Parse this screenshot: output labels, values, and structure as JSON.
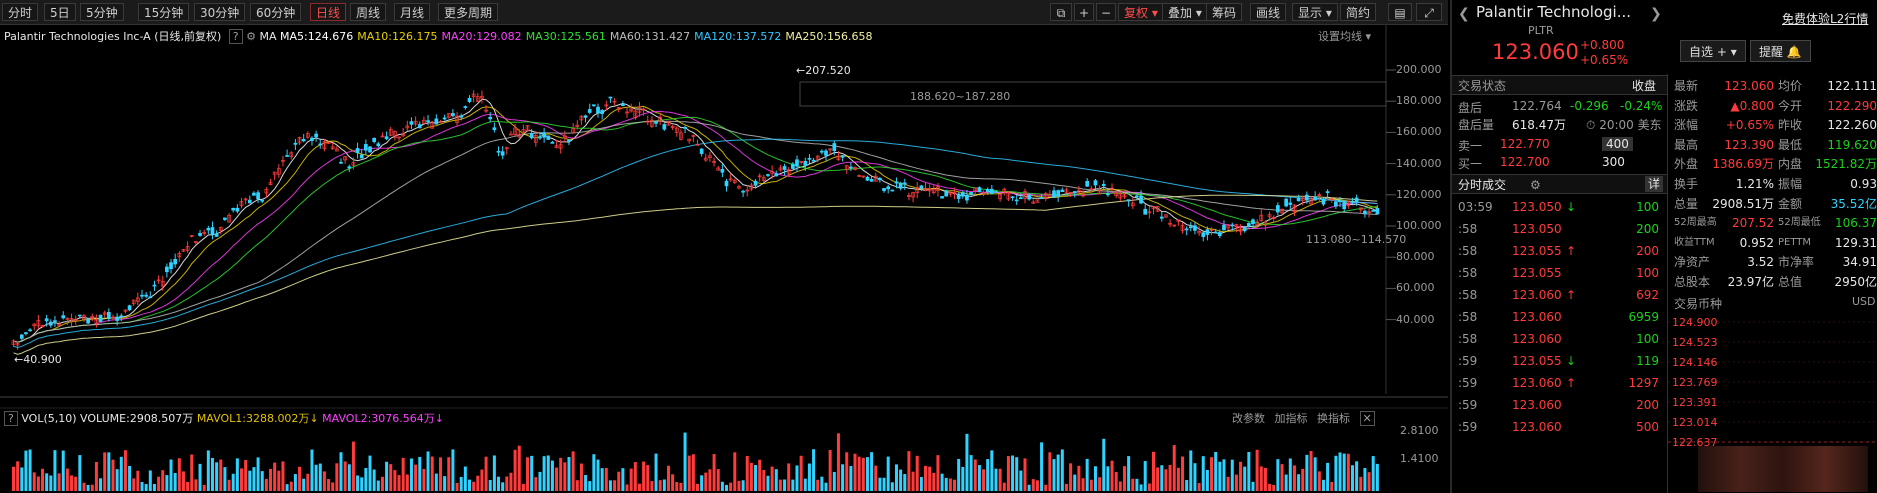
{
  "toolbar": {
    "periods": [
      "分时",
      "5日",
      "5分钟",
      "15分钟",
      "30分钟",
      "60分钟",
      "日线",
      "周线",
      "月线",
      "更多周期"
    ],
    "active_period": "日线",
    "right_buttons": [
      "复权",
      "叠加",
      "筹码",
      "画线",
      "显示",
      "简约"
    ]
  },
  "chart": {
    "title": "Palantir Technologies Inc-A (日线,前复权)",
    "ma_label": "MA",
    "ma": [
      {
        "label": "MA5:124.676",
        "color": "#ffffff"
      },
      {
        "label": "MA10:126.175",
        "color": "#e8d000"
      },
      {
        "label": "MA20:129.082",
        "color": "#ff40ff"
      },
      {
        "label": "MA30:125.561",
        "color": "#30e030"
      },
      {
        "label": "MA60:131.427",
        "color": "#bbbbbb"
      },
      {
        "label": "MA120:137.572",
        "color": "#30c8ff"
      },
      {
        "label": "MA250:156.658",
        "color": "#f0f0a0"
      }
    ],
    "settings_label": "设置均线",
    "price_axis": [
      "200.000",
      "180.000",
      "160.000",
      "140.000",
      "120.000",
      "100.000",
      "80.000",
      "60.000",
      "40.000"
    ],
    "annotations": {
      "high_label": "207.520",
      "range1": "188.620~187.280",
      "low_label": "113.080~114.570",
      "start_low": "40.900"
    }
  },
  "volume": {
    "title": "VOL(5,10)",
    "volume": "VOLUME:2908.507万",
    "mavol1": "MAVOL1:3288.002万",
    "mavol2": "MAVOL2:3076.564万",
    "links": [
      "改参数",
      "加指标",
      "换指标"
    ],
    "axis": [
      "2.8100",
      "1.4100"
    ]
  },
  "stock": {
    "name": "Palantir Technologi...",
    "code": "PLTR",
    "price": "123.060",
    "change": "+0.800",
    "change_pct": "+0.65%",
    "trial_link": "免费体验L2行情",
    "watch_button": "自选",
    "alert_button": "提醒"
  },
  "trade_status": {
    "title": "交易状态",
    "state": "收盘",
    "after_label": "盘后",
    "after_price": "122.764",
    "after_change": "-0.296",
    "after_pct": "-0.24%",
    "after_vol_label": "盘后量",
    "after_vol": "618.47万",
    "after_time": "20:00 美东",
    "ask_label": "卖一",
    "ask_price": "122.770",
    "ask_vol": "400",
    "bid_label": "买一",
    "bid_price": "122.700",
    "bid_vol": "300"
  },
  "ticks": {
    "title": "分时成交",
    "detail": "详",
    "rows": [
      {
        "time": "03:59",
        "price": "123.050",
        "arrow": "↓",
        "vol": "100",
        "pc": "red",
        "vc": "green"
      },
      {
        "time": ":58",
        "price": "123.050",
        "arrow": "",
        "vol": "200",
        "pc": "red",
        "vc": "green"
      },
      {
        "time": ":58",
        "price": "123.055",
        "arrow": "↑",
        "vol": "200",
        "pc": "red",
        "vc": "red"
      },
      {
        "time": ":58",
        "price": "123.055",
        "arrow": "",
        "vol": "100",
        "pc": "red",
        "vc": "red"
      },
      {
        "time": ":58",
        "price": "123.060",
        "arrow": "↑",
        "vol": "692",
        "pc": "red",
        "vc": "red"
      },
      {
        "time": ":58",
        "price": "123.060",
        "arrow": "",
        "vol": "6959",
        "pc": "red",
        "vc": "green"
      },
      {
        "time": ":58",
        "price": "123.060",
        "arrow": "",
        "vol": "100",
        "pc": "red",
        "vc": "green"
      },
      {
        "time": ":59",
        "price": "123.055",
        "arrow": "↓",
        "vol": "119",
        "pc": "red",
        "vc": "green"
      },
      {
        "time": ":59",
        "price": "123.060",
        "arrow": "↑",
        "vol": "1297",
        "pc": "red",
        "vc": "red"
      },
      {
        "time": ":59",
        "price": "123.060",
        "arrow": "",
        "vol": "200",
        "pc": "red",
        "vc": "red"
      },
      {
        "time": ":59",
        "price": "123.060",
        "arrow": "",
        "vol": "500",
        "pc": "red",
        "vc": "red"
      }
    ]
  },
  "quote": {
    "rows": [
      [
        {
          "k": "最新",
          "v": "123.060",
          "c": "red"
        },
        {
          "k": "均价",
          "v": "122.111",
          "c": "white"
        }
      ],
      [
        {
          "k": "涨跌",
          "v": "▲0.800",
          "c": "red"
        },
        {
          "k": "今开",
          "v": "122.290",
          "c": "red"
        }
      ],
      [
        {
          "k": "涨幅",
          "v": "+0.65%",
          "c": "red"
        },
        {
          "k": "昨收",
          "v": "122.260",
          "c": "white"
        }
      ],
      [
        {
          "k": "最高",
          "v": "123.390",
          "c": "red"
        },
        {
          "k": "最低",
          "v": "119.620",
          "c": "green"
        }
      ],
      [
        {
          "k": "外盘",
          "v": "1386.69万",
          "c": "red"
        },
        {
          "k": "内盘",
          "v": "1521.82万",
          "c": "green"
        }
      ],
      [
        {
          "k": "换手",
          "v": "1.21%",
          "c": "white"
        },
        {
          "k": "振幅",
          "v": "0.93",
          "c": "white"
        }
      ],
      [
        {
          "k": "总量",
          "v": "2908.51万",
          "c": "white"
        },
        {
          "k": "金额",
          "v": "35.52亿",
          "c": "cyan"
        }
      ],
      [
        {
          "k": "52周最高",
          "v": "207.52",
          "c": "red"
        },
        {
          "k": "52周最低",
          "v": "106.37",
          "c": "green"
        }
      ],
      [
        {
          "k": "收益TTM",
          "v": "0.952",
          "c": "white"
        },
        {
          "k": "PETTM",
          "v": "129.31",
          "c": "white"
        }
      ],
      [
        {
          "k": "净资产",
          "v": "3.52",
          "c": "white"
        },
        {
          "k": "市净率",
          "v": "34.91",
          "c": "white"
        }
      ],
      [
        {
          "k": "总股本",
          "v": "23.97亿",
          "c": "white"
        },
        {
          "k": "总值",
          "v": "2950亿",
          "c": "white"
        }
      ]
    ],
    "market_cap_label": "交易币种",
    "currency": "USD",
    "intraday_axis": [
      "124.900",
      "124.523",
      "124.146",
      "123.769",
      "123.391",
      "123.014",
      "122.637"
    ]
  },
  "colors": {
    "up": "#ff3b3b",
    "down": "#19d219",
    "accent": "#ff4d4d"
  }
}
